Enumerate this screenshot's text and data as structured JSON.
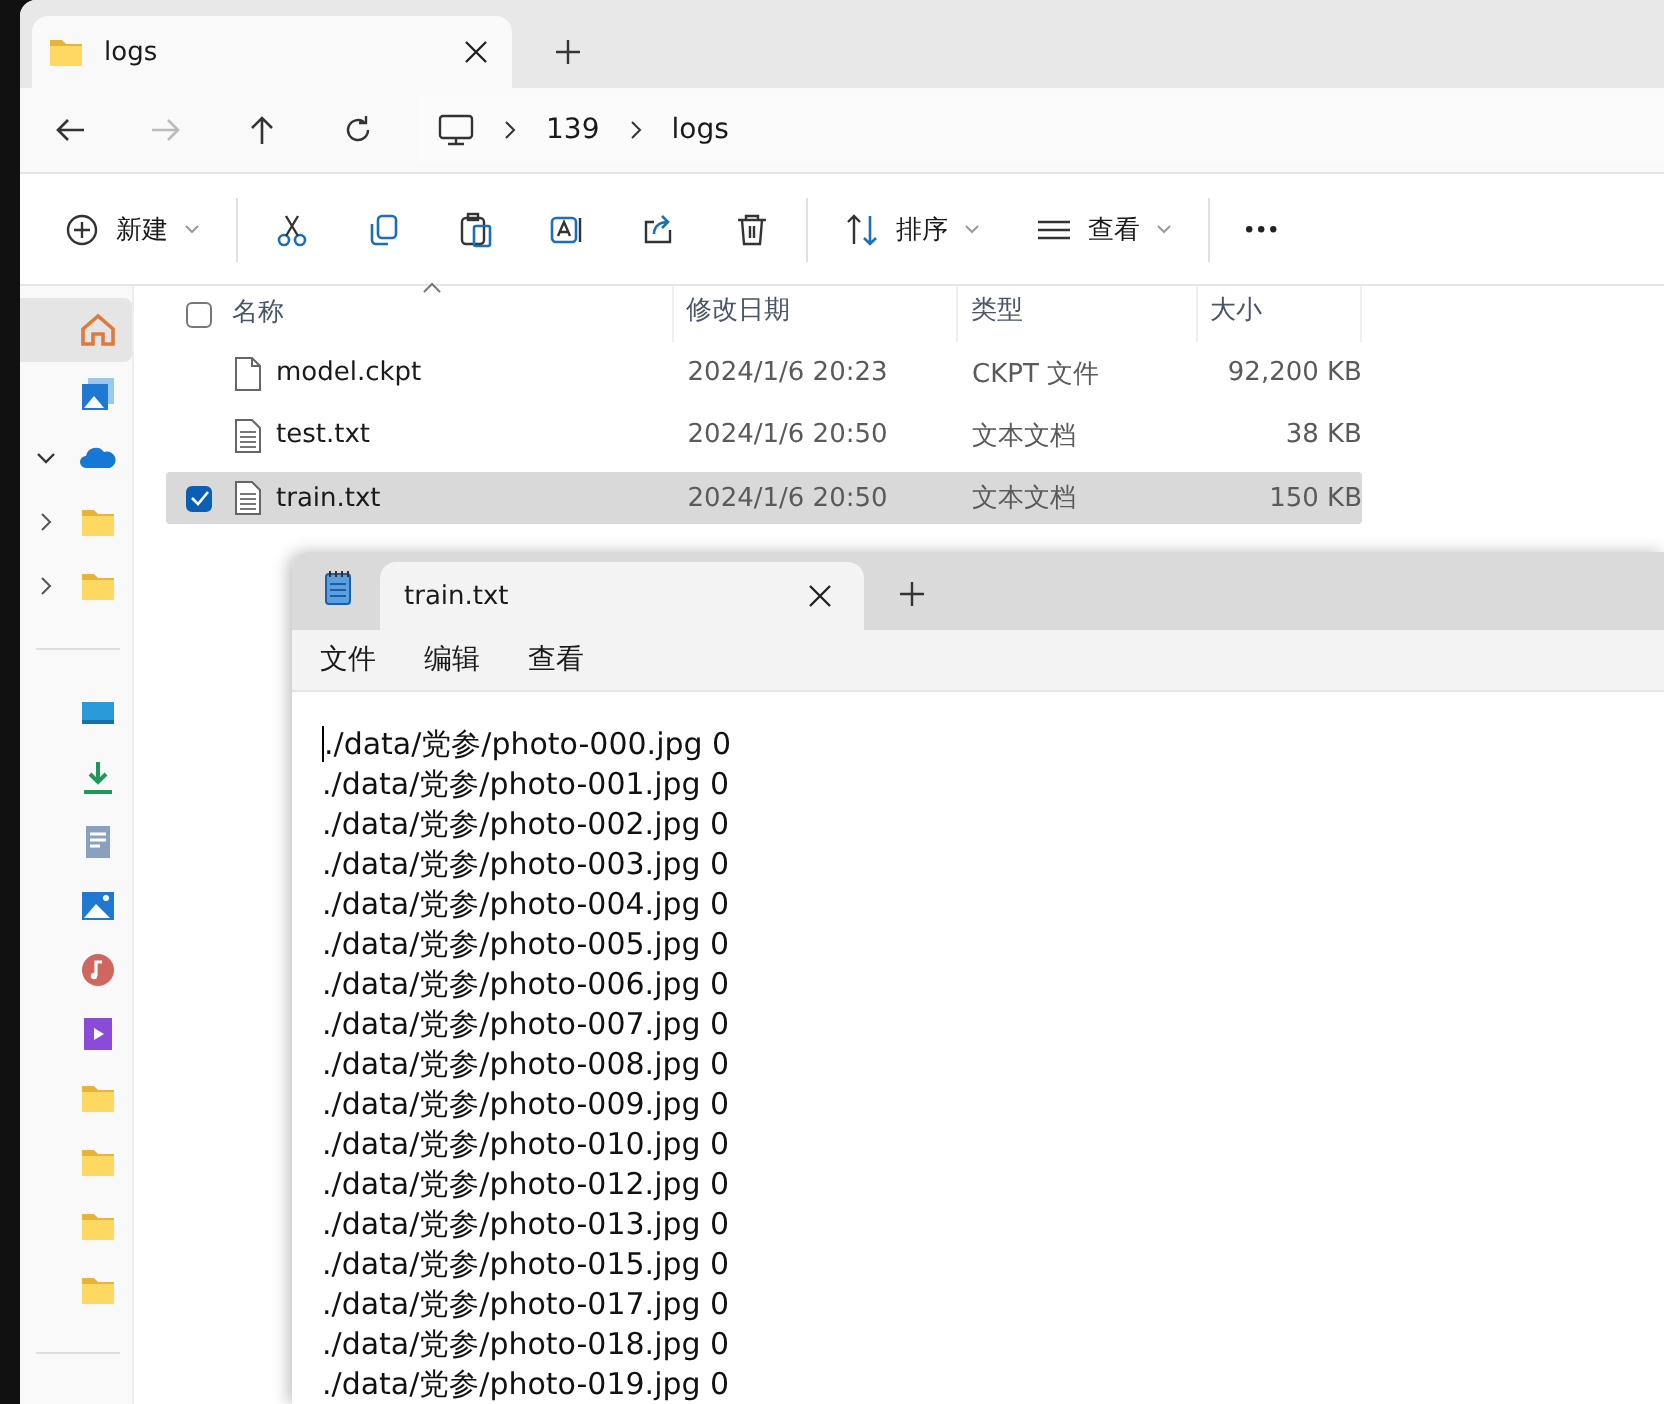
{
  "explorer": {
    "tab": {
      "title": "logs",
      "selected": true
    },
    "address": [
      "139",
      "logs"
    ],
    "toolbar": [
      {
        "kind": "new",
        "label": "新建"
      },
      {
        "kind": "cut"
      },
      {
        "kind": "copy"
      },
      {
        "kind": "paste"
      },
      {
        "kind": "rename"
      },
      {
        "kind": "share"
      },
      {
        "kind": "delete"
      },
      {
        "kind": "sort",
        "label": "排序"
      },
      {
        "kind": "view",
        "label": "查看"
      },
      {
        "kind": "more"
      }
    ],
    "sidebar": {
      "items": [
        {
          "kind": "home",
          "selected": true
        },
        {
          "kind": "gallery",
          "selected": false
        },
        {
          "kind": "cloud",
          "selected": false,
          "expanded": true,
          "children": [
            {
              "kind": "folder",
              "selected": false,
              "expanded": false
            },
            {
              "kind": "folder",
              "selected": false,
              "expanded": false
            }
          ]
        },
        {
          "kind": "divider"
        },
        {
          "kind": "desktop",
          "selected": false
        },
        {
          "kind": "download",
          "selected": false
        },
        {
          "kind": "documents",
          "selected": false
        },
        {
          "kind": "pictures",
          "selected": false
        },
        {
          "kind": "music",
          "selected": false
        },
        {
          "kind": "videos",
          "selected": false
        },
        {
          "kind": "folder",
          "selected": false
        },
        {
          "kind": "folder",
          "selected": false
        },
        {
          "kind": "folder",
          "selected": false
        },
        {
          "kind": "folder",
          "selected": false
        },
        {
          "kind": "divider"
        }
      ]
    },
    "table": {
      "all_checked": false,
      "columns": [
        "名称",
        "修改日期",
        "类型",
        "大小"
      ],
      "rows": [
        {
          "kind": "file",
          "name": "model.ckpt",
          "date": "2024/1/6 20:23",
          "type": "CKPT 文件",
          "size": "92,200 KB",
          "selected": false
        },
        {
          "kind": "text",
          "name": "test.txt",
          "date": "2024/1/6 20:50",
          "type": "文本文档",
          "size": "38 KB",
          "selected": false
        },
        {
          "kind": "text",
          "name": "train.txt",
          "date": "2024/1/6 20:50",
          "type": "文本文档",
          "size": "150 KB",
          "selected": true
        }
      ]
    }
  },
  "notepad": {
    "tab": {
      "title": "train.txt",
      "selected": true
    },
    "menus": [
      "文件",
      "编辑",
      "查看"
    ],
    "lines": [
      "./data/党参/photo-000.jpg 0",
      "./data/党参/photo-001.jpg 0",
      "./data/党参/photo-002.jpg 0",
      "./data/党参/photo-003.jpg 0",
      "./data/党参/photo-004.jpg 0",
      "./data/党参/photo-005.jpg 0",
      "./data/党参/photo-006.jpg 0",
      "./data/党参/photo-007.jpg 0",
      "./data/党参/photo-008.jpg 0",
      "./data/党参/photo-009.jpg 0",
      "./data/党参/photo-010.jpg 0",
      "./data/党参/photo-012.jpg 0",
      "./data/党参/photo-013.jpg 0",
      "./data/党参/photo-015.jpg 0",
      "./data/党参/photo-017.jpg 0",
      "./data/党参/photo-018.jpg 0",
      "./data/党参/photo-019.jpg 0"
    ]
  }
}
